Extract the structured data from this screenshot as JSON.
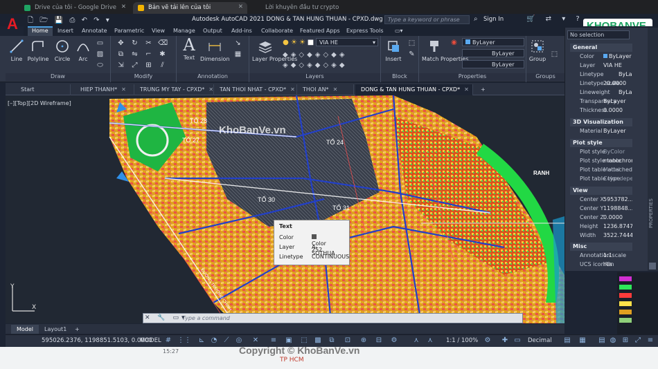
{
  "browser": {
    "tabs": [
      {
        "label": "Drive của tôi - Google Drive",
        "active": false,
        "color": "#1fa463"
      },
      {
        "label": "Bản vẽ tải lên của tôi",
        "active": true,
        "color": "#f4b400"
      },
      {
        "label": "Lời khuyên đầu tư crypto",
        "active": false,
        "color": "#888888"
      }
    ]
  },
  "app": {
    "logo": "A",
    "title": "Autodesk AutoCAD 2021   DONG & TAN HUNG THUAN - CPXD.dwg",
    "search_placeholder": "Type a keyword or phrase",
    "signin": "Sign In"
  },
  "ribbon": {
    "tabs": [
      "Home",
      "Insert",
      "Annotate",
      "Parametric",
      "View",
      "Manage",
      "Output",
      "Add-ins",
      "Collaborate",
      "Featured Apps",
      "Express Tools"
    ],
    "active_tab": "Home",
    "panels": {
      "draw": {
        "title": "Draw",
        "tools": [
          "Line",
          "Polyline",
          "Circle",
          "Arc"
        ]
      },
      "modify": {
        "title": "Modify"
      },
      "annotation": {
        "title": "Annotation",
        "tools": [
          "Text",
          "Dimension"
        ]
      },
      "layers": {
        "title": "Layers",
        "tool": "Layer Properties",
        "current_layer": "VIA HE"
      },
      "block": {
        "title": "Block",
        "tool": "Insert"
      },
      "properties": {
        "title": "Properties",
        "tool": "Match Properties",
        "color": "ByLayer",
        "linetype": "ByLayer",
        "lineweight": "ByLayer"
      },
      "groups": {
        "title": "Groups",
        "tool": "Group"
      }
    }
  },
  "doc_tabs": [
    {
      "label": "Start",
      "active": false,
      "closable": false
    },
    {
      "label": "HIEP THANH*",
      "active": false,
      "closable": true
    },
    {
      "label": "TRUNG MY TAY - CPXD*",
      "active": false,
      "closable": true
    },
    {
      "label": "TAN THOI NHAT - CPXD*",
      "active": false,
      "closable": true
    },
    {
      "label": "THOI AN*",
      "active": false,
      "closable": true
    },
    {
      "label": "DONG & TAN HUNG THUAN - CPXD*",
      "active": true,
      "closable": true
    }
  ],
  "viewport": {
    "label": "[–][Top][2D Wireframe]",
    "map_labels": [
      "TỔ 28",
      "TỔ 27",
      "TỔ 24",
      "TỔ 30",
      "TỔ 31",
      "RANH",
      "ĐƯỜNG TRƯỜNG CHINH"
    ],
    "tooltip": {
      "title": "Text",
      "rows": [
        {
          "key": "Color",
          "value": "Color 252"
        },
        {
          "key": "Layer",
          "value": "A-SOTHUA"
        },
        {
          "key": "Linetype",
          "value": "CONTINUOUS"
        }
      ]
    }
  },
  "command": {
    "placeholder": "Type a command"
  },
  "layout_tabs": [
    {
      "label": "Model",
      "active": true
    },
    {
      "label": "Layout1",
      "active": false
    }
  ],
  "status": {
    "coords": "595026.2376, 1198851.5103, 0.0000",
    "space": "MODEL",
    "scale": "1:1 / 100%",
    "units": "Decimal"
  },
  "properties": {
    "selection": "No selection",
    "sections": [
      {
        "title": "General",
        "rows": [
          {
            "key": "Color",
            "value": "ByLayer"
          },
          {
            "key": "Layer",
            "value": "VIA HE"
          },
          {
            "key": "Linetype",
            "value": "ByLayer"
          },
          {
            "key": "Linetype scale",
            "value": "20.0000"
          },
          {
            "key": "Lineweight",
            "value": "ByLayer"
          },
          {
            "key": "Transparency",
            "value": "ByLayer"
          },
          {
            "key": "Thickness",
            "value": "0.0000"
          }
        ]
      },
      {
        "title": "3D Visualization",
        "rows": [
          {
            "key": "Material",
            "value": "ByLayer"
          }
        ]
      },
      {
        "title": "Plot style",
        "rows": [
          {
            "key": "Plot style",
            "value": "ByColor"
          },
          {
            "key": "Plot style table",
            "value": "monochrome"
          },
          {
            "key": "Plot table attached",
            "value": "Model"
          },
          {
            "key": "Plot table type",
            "value": "Color dependent"
          }
        ]
      },
      {
        "title": "View",
        "rows": [
          {
            "key": "Center X",
            "value": "5953782..."
          },
          {
            "key": "Center Y",
            "value": "1198848..."
          },
          {
            "key": "Center Z",
            "value": "0.0000"
          },
          {
            "key": "Height",
            "value": "1236.8747"
          },
          {
            "key": "Width",
            "value": "3522.7444"
          }
        ]
      },
      {
        "title": "Misc",
        "rows": [
          {
            "key": "Annotation scale",
            "value": "1:1"
          },
          {
            "key": "UCS icon On",
            "value": "Yes"
          }
        ]
      }
    ],
    "vertical_label": "PROPERTIES"
  },
  "web_below": {
    "time": "15:27",
    "text": "TP HCM"
  },
  "watermarks": {
    "top": "KhoBanVe.vn",
    "bottom": "Copyright © KhoBanVe.vn",
    "logo": "KHOBANVE"
  }
}
